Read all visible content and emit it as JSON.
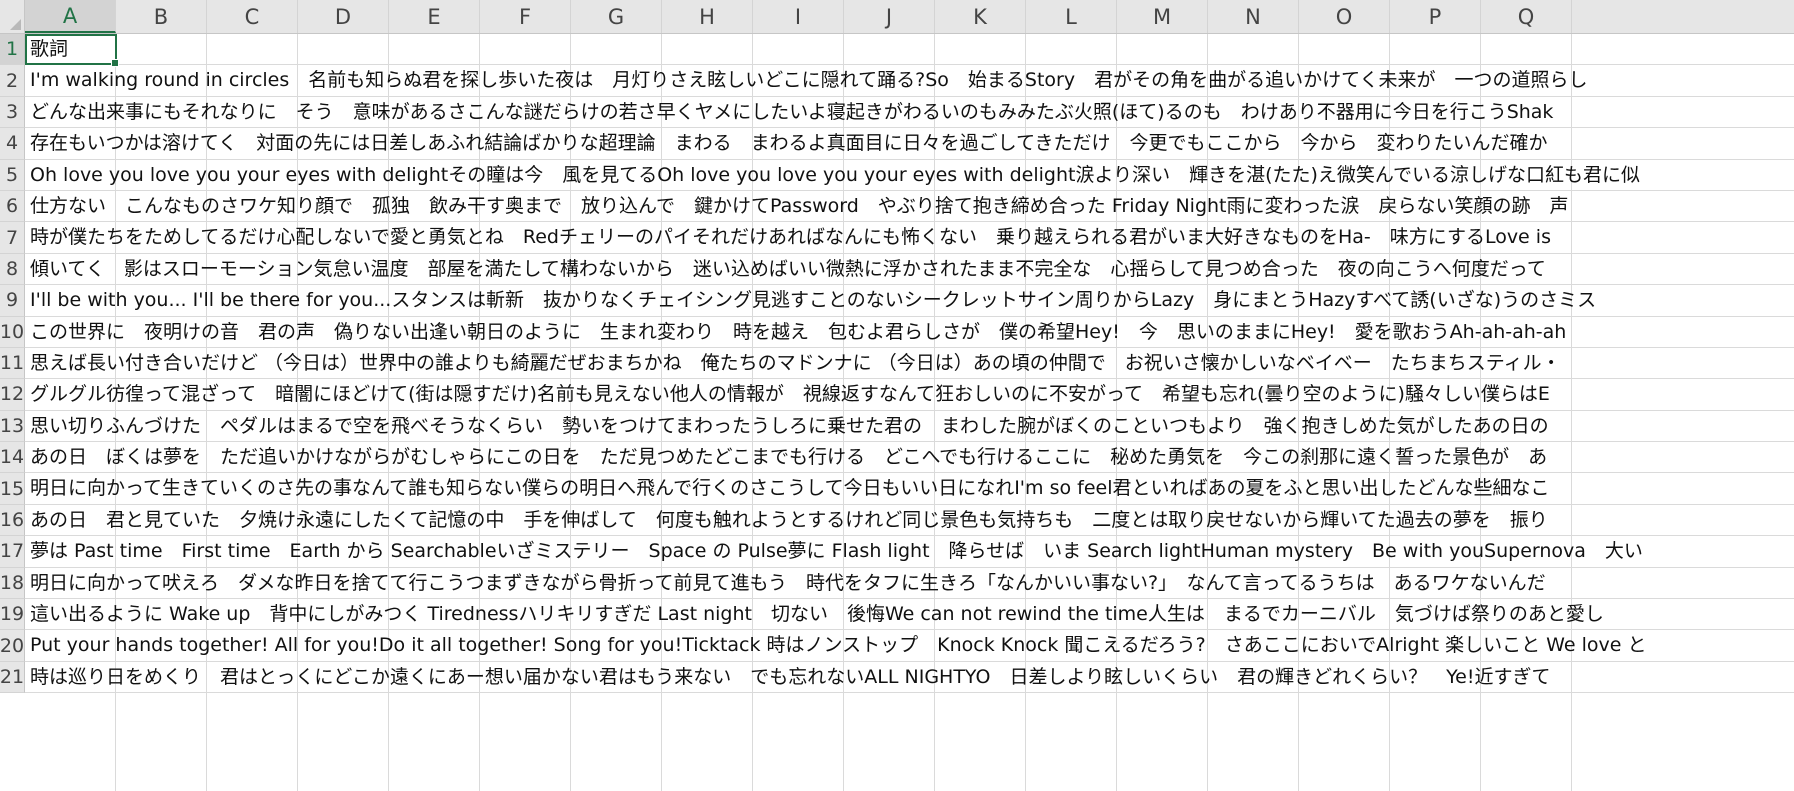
{
  "columns": [
    "A",
    "B",
    "C",
    "D",
    "E",
    "F",
    "G",
    "H",
    "I",
    "J",
    "K",
    "L",
    "M",
    "N",
    "O",
    "P",
    "Q"
  ],
  "active_column": "A",
  "active_row": "1",
  "rows": [
    {
      "num": "1",
      "text": "歌詞"
    },
    {
      "num": "2",
      "text": "I'm walking round in circles　名前も知らぬ君を探し歩いた夜は　月灯りさえ眩しいどこに隠れて踊る?So　始まるStory　君がその角を曲がる追いかけてく未来が　一つの道照らし"
    },
    {
      "num": "3",
      "text": "どんな出来事にもそれなりに　そう　意味があるさこんな謎だらけの若さ早くヤメにしたいよ寝起きがわるいのもみみたぶ火照(ほて)るのも　わけあり不器用に今日を行こうShak"
    },
    {
      "num": "4",
      "text": "存在もいつかは溶けてく　対面の先には日差しあふれ結論ばかりな超理論　まわる　まわるよ真面目に日々を過ごしてきただけ　今更でもここから　今から　変わりたいんだ確か"
    },
    {
      "num": "5",
      "text": "Oh love you love you your eyes with delightその瞳は今　風を見てるOh love you love you your eyes with delight涙より深い　輝きを湛(たた)え微笑んでいる涼しげな口紅も君に似"
    },
    {
      "num": "6",
      "text": "仕方ない　こんなものさワケ知り顔で　孤独　飲み干す奥まで　放り込んで　鍵かけてPassword　やぶり捨て抱き締め合った Friday Night雨に変わった涙　戻らない笑顔の跡　声"
    },
    {
      "num": "7",
      "text": "時が僕たちをためしてるだけ心配しないで愛と勇気とね　Redチェリーのパイそれだけあればなんにも怖くない　乗り越えられる君がいま大好きなものをHa-　味方にするLove is"
    },
    {
      "num": "8",
      "text": "傾いてく　影はスローモーション気怠い温度　部屋を満たして構わないから　迷い込めばいい微熱に浮かされたまま不完全な　心揺らして見つめ合った　夜の向こうへ何度だって"
    },
    {
      "num": "9",
      "text": "I'll be with you... I'll be there for you...スタンスは斬新　抜かりなくチェイシング見逃すことのないシークレットサイン周りからLazy　身にまとうHazyすべて誘(いざな)うのさミス"
    },
    {
      "num": "10",
      "text": "この世界に　夜明けの音　君の声　偽りない出逢い朝日のように　生まれ変わり　時を越え　包むよ君らしさが　僕の希望Hey!　今　思いのままにHey!　愛を歌おうAh-ah-ah-ah"
    },
    {
      "num": "11",
      "text": "思えば長い付き合いだけど （今日は）世界中の誰よりも綺麗だぜおまちかね　俺たちのマドンナに （今日は）あの頃の仲間で　お祝いさ懐かしいなベイベー　たちまちスティル・"
    },
    {
      "num": "12",
      "text": "グルグル彷徨って混ざって　暗闇にほどけて(街は隠すだけ)名前も見えない他人の情報が　視線返すなんて狂おしいのに不安がって　希望も忘れ(曇り空のように)騒々しい僕らはE"
    },
    {
      "num": "13",
      "text": "思い切りふんづけた　ペダルはまるで空を飛べそうなくらい　勢いをつけてまわったうしろに乗せた君の　まわした腕がぼくのこといつもより　強く抱きしめた気がしたあの日の"
    },
    {
      "num": "14",
      "text": "あの日　ぼくは夢を　ただ追いかけながらがむしゃらにこの日を　ただ見つめたどこまでも行ける　どこへでも行けるここに　秘めた勇気を　今この刹那に遠く誓った景色が　あ"
    },
    {
      "num": "15",
      "text": "明日に向かって生きていくのさ先の事なんて誰も知らない僕らの明日へ飛んで行くのさこうして今日もいい日になれI'm so feel君といればあの夏をふと思い出したどんな些細なこ"
    },
    {
      "num": "16",
      "text": "あの日　君と見ていた　夕焼け永遠にしたくて記憶の中　手を伸ばして　何度も触れようとするけれど同じ景色も気持ちも　二度とは取り戻せないから輝いてた過去の夢を　振り"
    },
    {
      "num": "17",
      "text": "夢は Past time　First time　Earth から Searchableいざミステリー　Space の Pulse夢に Flash light　降らせば　いま Search lightHuman mystery　Be with youSupernova　大い"
    },
    {
      "num": "18",
      "text": "明日に向かって吠えろ　ダメな昨日を捨てて行こうつまずきながら骨折って前見て進もう　時代をタフに生きろ「なんかいい事ない?」　なんて言ってるうちは　あるワケないんだ"
    },
    {
      "num": "19",
      "text": "這い出るように Wake up　背中にしがみつく Tirednessハリキリすぎだ Last night　切ない　後悔We can not rewind the time人生は　まるでカーニバル　気づけば祭りのあと愛し"
    },
    {
      "num": "20",
      "text": "Put your hands together! All for you!Do it all together! Song for you!Ticktack 時はノンストップ　Knock Knock 聞こえるだろう?　さあここにおいでAlright 楽しいこと We love と"
    },
    {
      "num": "21",
      "text": "時は巡り日をめくり　君はとっくにどこか遠くにあー想い届かない君はもう来ない　でも忘れないALL NIGHTYO　日差しより眩しいくらい　君の輝きどれくらい？　Ye!近すぎて"
    }
  ]
}
